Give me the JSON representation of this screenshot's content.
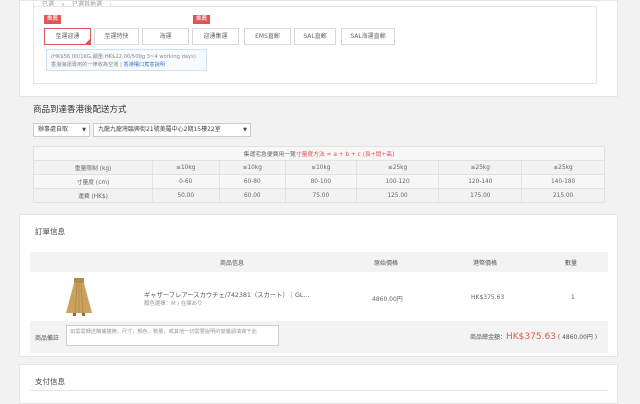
{
  "tabs": [
    "已選",
    "已選其他選"
  ],
  "shipping": {
    "badge_recommend": "推薦",
    "options": [
      "至運迎湧",
      "至運特快",
      "海運",
      "迎湧集運",
      "EMS直郵",
      "SAL直郵",
      "SAL海運直郵"
    ],
    "note_line1": "(HK$56.00/1KG,續重:HK$22.00/500g 3~4 working days)",
    "note_line2_prefix": "香港海運專用的一律收為空運 | ",
    "note_link": "香港權口篤意說明"
  },
  "delivery": {
    "title": "商品到達香港後配送方式",
    "method": "辦事處自取",
    "address": "九龍九龍灣臨興街21號美羅中心2期15樓22室"
  },
  "rate_table": {
    "heading_prefix": "集運宅急便費用一覽",
    "heading_formula": "寸量度方法 = a + b + c (長+闊+高)",
    "row_labels": [
      "重量限制 (kg)",
      "寸量度 (cm)",
      "運費 (HK$)"
    ],
    "weights": [
      "≤10kg",
      "≤10kg",
      "≤10kg",
      "≤25kg",
      "≤25kg",
      "≤25kg"
    ],
    "sizes": [
      "0-60",
      "60-80",
      "80-100",
      "100-120",
      "120-140",
      "140-180"
    ],
    "fees": [
      "50.00",
      "60.00",
      "75.00",
      "125.00",
      "175.00",
      "215.00"
    ]
  },
  "order": {
    "title": "訂單信息",
    "headers": {
      "info": "商品信息",
      "price_jp": "原始價格",
      "price_hk": "港幣價格",
      "qty": "數量"
    },
    "item": {
      "name": "ギャザーフレアースカウチェ/742381（スカート）｜GL...",
      "attrs": "顏色選擇：M / 在庫あり",
      "price_jp": "4860.00円",
      "price_hk": "HK$375.63",
      "qty": "1"
    },
    "remark_label": "商品備註",
    "remark_placeholder": "如需需轉送購補描摘，尺寸，顏色，數量，或其他一切需要說明的變履請填寫于此",
    "total_label": "商品總金額：",
    "total_hk": "HK$375.63",
    "total_jp": "( 4860.00円 )"
  },
  "payment": {
    "title": "支付信息"
  }
}
